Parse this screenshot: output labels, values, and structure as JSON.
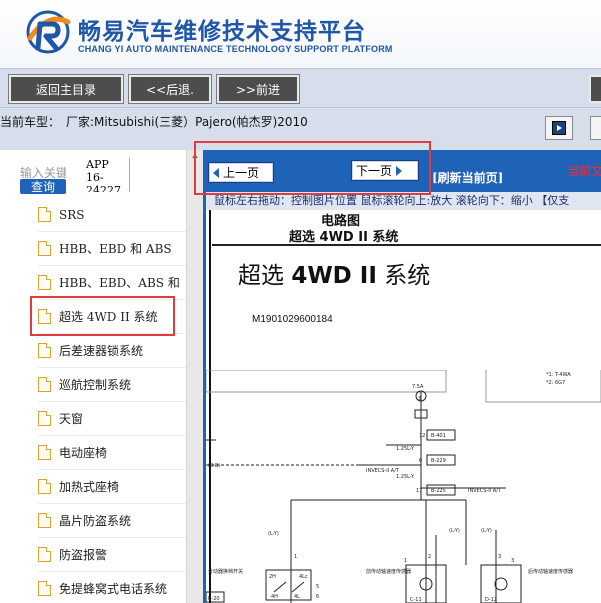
{
  "header": {
    "title_cn": "畅易汽车维修技术支持平台",
    "title_en": "CHANG YI AUTO MAINTENANCE TECHNOLOGY SUPPORT PLATFORM"
  },
  "nav": {
    "home": "返回主目录",
    "back": "<<后退.",
    "forward": ">>前进"
  },
  "vehicle": {
    "label": "当前车型：",
    "value": "厂家:Mitsubishi(三菱）Pajero(帕杰罗)2010"
  },
  "search": {
    "label": "输入关键",
    "button": "查询",
    "value_line1": "APP 16-",
    "value_line2": "24227"
  },
  "tree": [
    {
      "label": "SRS"
    },
    {
      "label": "HBB、EBD 和 ABS"
    },
    {
      "label": "HBB、EBD、ABS 和"
    },
    {
      "label": "超选 4WD II 系统"
    },
    {
      "label": "后差速器锁系统"
    },
    {
      "label": "巡航控制系统"
    },
    {
      "label": "天窗"
    },
    {
      "label": "电动座椅"
    },
    {
      "label": "加热式座椅"
    },
    {
      "label": "晶片防盗系统"
    },
    {
      "label": "防盗报警"
    },
    {
      "label": "免提蜂窝式电话系统"
    }
  ],
  "viewer": {
    "prev": "上一页",
    "next": "下一页",
    "refresh": "[刷新当前页]",
    "current": "当前文",
    "hint": "鼠标左右拖动：控制图片位置  鼠标滚轮向上:放大  滚轮向下：缩小 【仅支"
  },
  "document": {
    "header1": "电路图",
    "header2": "超选 4WD II 系统",
    "title_prefix": "超选 ",
    "title_bold": "4WD II",
    "title_suffix": " 系统",
    "code": "M1901029600184",
    "labels": {
      "conn1": "12",
      "conn1_pin": "B-401",
      "conn2": "6",
      "conn2_pin": "B-229",
      "conn3": "17",
      "conn3_pin": "B-225",
      "wire1": "1.25L-Y",
      "wire2": "1.25L-Y",
      "wire3": "(L-Y)",
      "wire4": "(L-Y)",
      "wire5": "(L-Y)",
      "fuse": "7.5A",
      "invecs1": "INVECS-II A/T",
      "invecs2": "INVECS-II A/T",
      "left_tag": "(B-B)",
      "left_conn": "B-20",
      "conn_c": "C-11",
      "conn_d": "D-12",
      "num1": "1",
      "num2": "2",
      "num3": "3",
      "legend1": "*1: T-4WA",
      "legend2": "*2: 6G7",
      "switch_label": "分动器换档开关",
      "sensor1": "前传动轴速度传感器",
      "sensor2": "后传动轴速度传感器",
      "pin_2h": "2H",
      "pin_4lc": "4Lc",
      "pin_4h": "4H",
      "pin_4lf": "4L",
      "pin5": "5",
      "pin6": "6",
      "pin1a": "1",
      "pin3a": "3"
    }
  },
  "colors": {
    "brand_blue": "#1f56a8",
    "toolbar_blue": "#1f63b8",
    "highlight_red": "#e23b3b",
    "nav_dark": "#4d4d4d"
  }
}
